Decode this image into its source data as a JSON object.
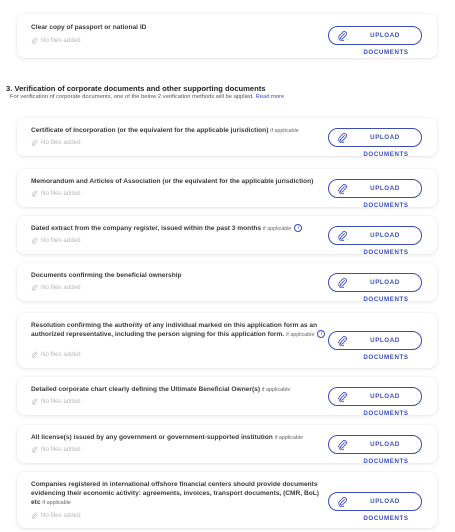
{
  "no_files": "No files added",
  "upload": {
    "line1": "UPLOAD",
    "line2": "DOCUMENTS"
  },
  "section": {
    "title": "3. Verification of corporate documents and other supporting documents",
    "subtitle": "For verification of corporate documents, one of the below 2 verification methods will be applied.",
    "read_more": "Read more"
  },
  "cards": [
    {
      "title": "Clear copy of passport or national ID",
      "optional": "",
      "info": false
    },
    {
      "title": "Certificate of Incorporation (or the equivalent for the applicable jurisdiction)",
      "optional": "if applicable",
      "info": false
    },
    {
      "title": "Memorandum and Articles of Association (or the equivalent for the applicable jurisdiction)",
      "optional": "",
      "info": false
    },
    {
      "title": "Dated extract from the company register, issued within the past 3 months",
      "optional": "if applicable",
      "info": true
    },
    {
      "title": "Documents confirming the beneficial ownership",
      "optional": "",
      "info": false
    },
    {
      "title": "Resolution confirming the authority of any individual marked on this application form as an authorized representative, including the person signing for this application form.",
      "optional": "if applicable",
      "info": true
    },
    {
      "title": "Detailed corporate chart clearly defining the Ultimate Beneficial Owner(s)",
      "optional": "if applicable",
      "info": false
    },
    {
      "title": "All license(s) issued by any government or government-supported institution",
      "optional": "if applicable",
      "info": false
    },
    {
      "title": "Companies registered in international offshore financial centers should provide documents evidencing their economic activity: agreements, invoices, transport documents, (CMR, BoL) etc",
      "optional": "if applicable",
      "info": false
    }
  ],
  "info_glyph": "i",
  "colors": {
    "accent": "#3b4cb8",
    "muted": "#b8b8b8"
  }
}
